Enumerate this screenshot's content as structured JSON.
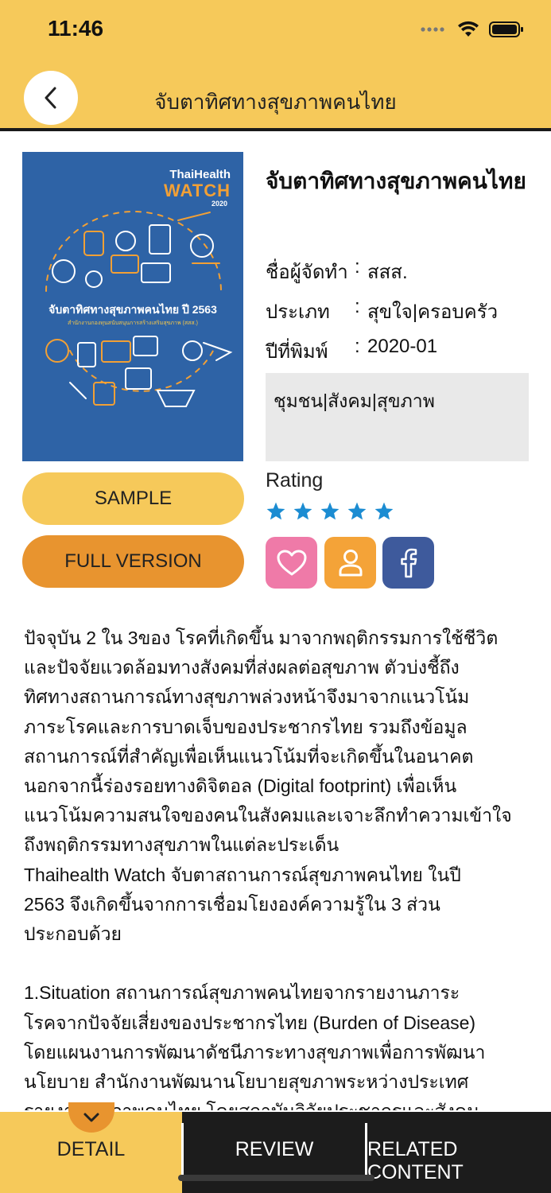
{
  "status_bar": {
    "time": "11:46"
  },
  "header": {
    "title": "จับตาทิศทางสุขภาพคนไทย"
  },
  "cover": {
    "brand_line1": "ThaiHealth",
    "brand_line2": "WATCH",
    "brand_line3": "2020",
    "title": "จับตาทิศทางสุขภาพคนไทย ปี 2563",
    "subtitle": "สำนักงานกองทุนสนับสนุนการสร้างเสริมสุขภาพ (สสส.)"
  },
  "book": {
    "title": "จับตาทิศทางสุขภาพคนไทย",
    "author_label": "ชื่อผู้จัดทำ",
    "author": "สสส.",
    "category_label": "ประเภท",
    "category": "สุขใจ|ครอบครัว",
    "year_label": "ปีที่พิมพ์",
    "year": "2020-01",
    "separator": ":",
    "tags": "ชุมชน|สังคม|สุขภาพ"
  },
  "rating": {
    "label": "Rating",
    "stars": 5,
    "max": 5,
    "star_color": "#1b8cd2"
  },
  "buttons": {
    "sample": "SAMPLE",
    "full_version": "FULL VERSION"
  },
  "social": {
    "favorite_icon": "heart-icon",
    "profile_icon": "user-icon",
    "facebook_icon": "facebook-icon",
    "colors": {
      "favorite": "#ef7aa8",
      "profile": "#f4a338",
      "facebook": "#3e5a9c"
    }
  },
  "description": "ปัจจุบัน 2 ใน 3ของ โรคที่เกิดขึ้น มาจากพฤติกรรมการใช้ชีวิต\nและปัจจัยแวดล้อมทางสังคมที่ส่งผลต่อสุขภาพ ตัวบ่งชี้ถึง\nทิศทางสถานการณ์ทางสุขภาพล่วงหน้าจึงมาจากแนวโน้ม\nภาระโรคและการบาดเจ็บของประชากรไทย รวมถึงข้อมูล\nสถานการณ์ที่สำคัญเพื่อเห็นแนวโน้มที่จะเกิดขึ้นในอนาคต\nนอกจากนี้ร่องรอยทางดิจิตอล (Digital footprint) เพื่อเห็น\nแนวโน้มความสนใจของคนในสังคมและเจาะลึกทำความเข้าใจ\nถึงพฤติกรรมทางสุขภาพในแต่ละประเด็น\nThaihealth Watch จับตาสถานการณ์สุขภาพคนไทย ในปี\n2563 จึงเกิดขึ้นจากการเชื่อมโยงองค์ความรู้ใน 3 ส่วน\nประกอบด้วย\n\n1.Situation สถานการณ์สุขภาพคนไทยจากรายงานภาระ\nโรคจากปัจจัยเสี่ยงของประชากรไทย (Burden of Disease)\nโดยแผนงานการพัฒนาดัชนีภาระทางสุขภาพเพื่อการพัฒนา\nนโยบาย สำนักงานพัฒนานโยบายสุขภาพระหว่างประเทศ\nรายงานสุขภาพคนไทย โดยสถาบันวิจัยประชากรและสังคม",
  "tabs": [
    {
      "label": "DETAIL",
      "active": true
    },
    {
      "label": "REVIEW",
      "active": false
    },
    {
      "label": "RELATED CONTENT",
      "active": false
    }
  ],
  "colors": {
    "accent_yellow": "#f6c95a",
    "accent_orange": "#e8942f",
    "tabbar": "#1c1c1c"
  }
}
